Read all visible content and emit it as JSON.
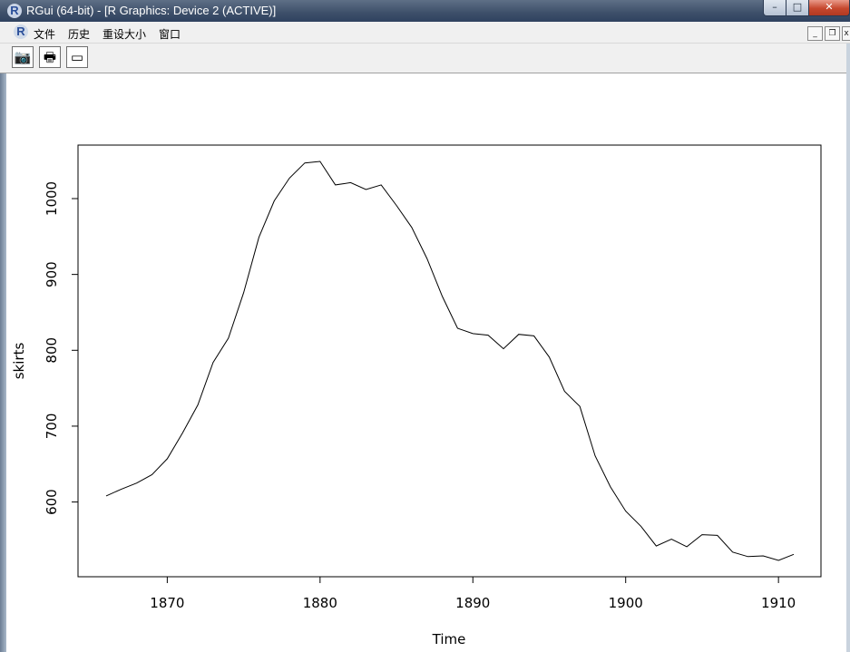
{
  "window": {
    "title": "RGui (64-bit) - [R Graphics: Device 2 (ACTIVE)]",
    "app_icon_letter": "R",
    "controls": {
      "minimize": "–",
      "maximize": "□",
      "close": "✕"
    }
  },
  "menu": {
    "items": [
      "文件",
      "历史",
      "重设大小",
      "窗口"
    ],
    "mdi_controls": {
      "minimize": "_",
      "restore": "❐",
      "close": "x"
    }
  },
  "toolbar": {
    "buttons": [
      {
        "icon": "camera-icon",
        "glyph": "📷"
      },
      {
        "icon": "printer-icon",
        "glyph": "🖶"
      },
      {
        "icon": "window-icon",
        "glyph": "▭"
      }
    ]
  },
  "chart_data": {
    "type": "line",
    "xlabel": "Time",
    "ylabel": "skirts",
    "xlim": [
      1866,
      1911
    ],
    "ylim": [
      523,
      1049
    ],
    "x_ticks": [
      1870,
      1880,
      1890,
      1900,
      1910
    ],
    "y_ticks": [
      600,
      700,
      800,
      900,
      1000
    ],
    "grid": false,
    "series": [
      {
        "x": [
          1866,
          1867,
          1868,
          1869,
          1870,
          1871,
          1872,
          1873,
          1874,
          1875,
          1876,
          1877,
          1878,
          1879,
          1880,
          1881,
          1882,
          1883,
          1884,
          1885,
          1886,
          1887,
          1888,
          1889,
          1890,
          1891,
          1892,
          1893,
          1894,
          1895,
          1896,
          1897,
          1898,
          1899,
          1900,
          1901,
          1902,
          1903,
          1904,
          1905,
          1906,
          1907,
          1908,
          1909,
          1910,
          1911
        ],
        "y": [
          608,
          617,
          625,
          636,
          657,
          691,
          728,
          784,
          816,
          876,
          949,
          997,
          1027,
          1047,
          1049,
          1018,
          1021,
          1012,
          1018,
          991,
          962,
          921,
          871,
          829,
          822,
          820,
          802,
          821,
          819,
          791,
          746,
          726,
          661,
          620,
          588,
          568,
          542,
          551,
          541,
          557,
          556,
          534,
          528,
          529,
          523,
          531
        ]
      }
    ]
  }
}
